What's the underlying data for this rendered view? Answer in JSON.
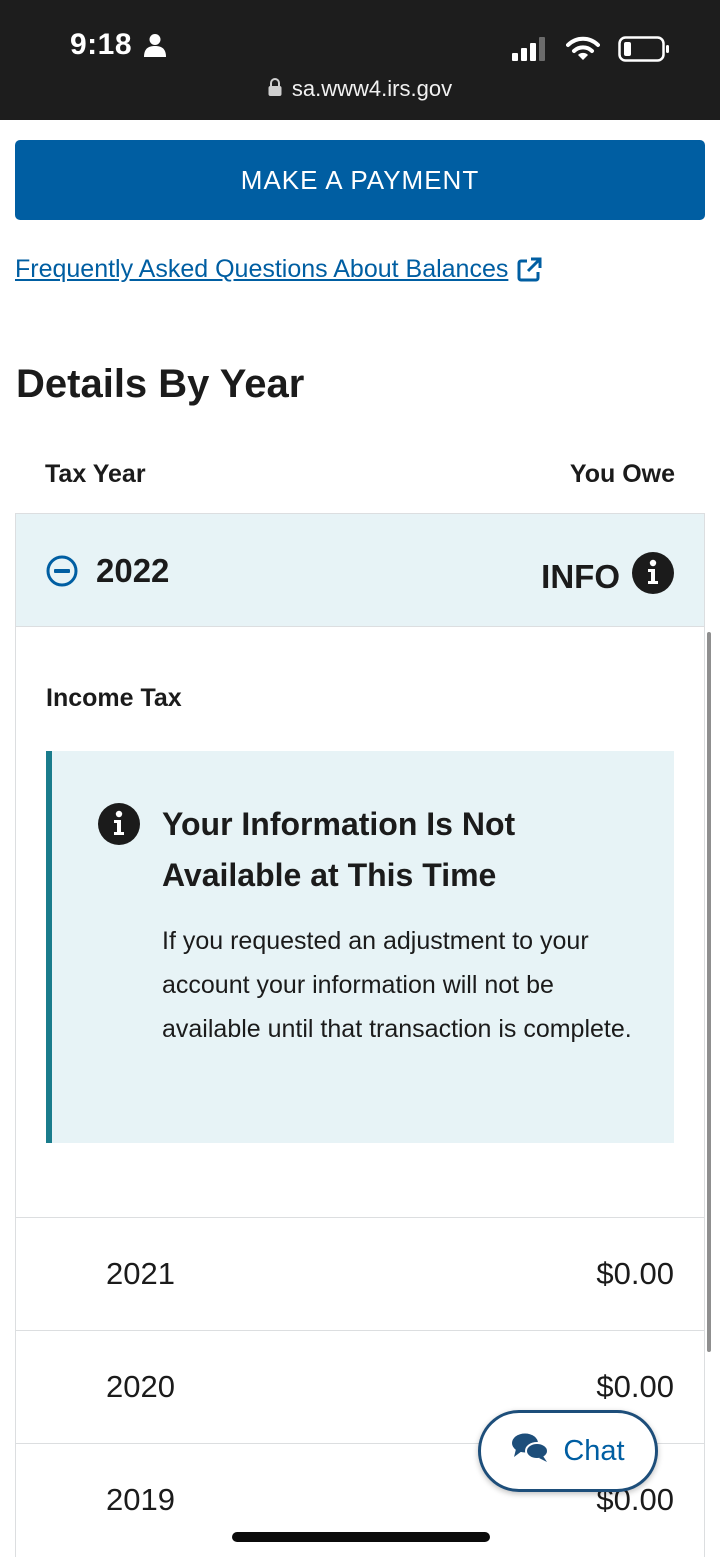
{
  "status_bar": {
    "time": "9:18",
    "url": "sa.www4.irs.gov"
  },
  "actions": {
    "make_payment": "MAKE A PAYMENT",
    "faq_link": "Frequently Asked Questions About Balances"
  },
  "details": {
    "title": "Details By Year",
    "col_tax_year": "Tax Year",
    "col_you_owe": "You Owe",
    "expanded": {
      "year": "2022",
      "info_label": "INFO",
      "section_label": "Income Tax",
      "alert": {
        "title": "Your Information Is Not Available at This Time",
        "body": "If you requested an adjustment to your account your information will not be available until that transaction is complete."
      }
    },
    "rows": [
      {
        "year": "2021",
        "amount": "$0.00"
      },
      {
        "year": "2020",
        "amount": "$0.00"
      },
      {
        "year": "2019",
        "amount": "$0.00"
      }
    ]
  },
  "chat": {
    "label": "Chat"
  },
  "colors": {
    "primary": "#005ea2",
    "info_bg": "#e7f3f6",
    "alert_border": "#1a7c8c",
    "status_bar_bg": "#1d1d1d"
  },
  "icons": {
    "person": "person-icon",
    "signal": "signal-icon",
    "wifi": "wifi-icon",
    "battery": "battery-icon",
    "lock": "lock-icon",
    "external_link": "external-link-icon",
    "collapse": "minus-circle-icon",
    "info": "info-circle-icon",
    "chat": "chat-bubbles-icon"
  }
}
